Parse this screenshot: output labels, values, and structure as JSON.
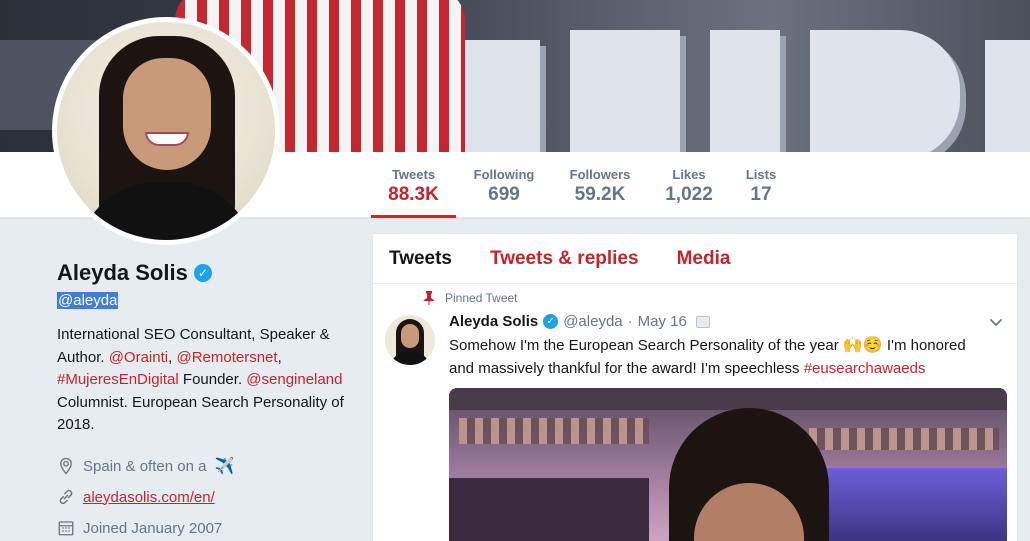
{
  "profile": {
    "name": "Aleyda Solis",
    "handle": "@aleyda",
    "bio": {
      "p1": "International SEO Consultant, Speaker & Author. ",
      "m1": "@Orainti",
      "sep1": ", ",
      "m2": "@Remotersnet",
      "sep2": ", ",
      "m3": "#MujeresEnDigital",
      "p2": " Founder. ",
      "m4": "@sengineland",
      "p3": " Columnist. European Search Personality of 2018."
    },
    "location": "Spain & often on a",
    "location_emoji": "✈️",
    "website": "aleydasolis.com/en/",
    "joined": "Joined January 2007"
  },
  "stats": [
    {
      "label": "Tweets",
      "value": "88.3K"
    },
    {
      "label": "Following",
      "value": "699"
    },
    {
      "label": "Followers",
      "value": "59.2K"
    },
    {
      "label": "Likes",
      "value": "1,022"
    },
    {
      "label": "Lists",
      "value": "17"
    }
  ],
  "tabs": [
    {
      "label": "Tweets"
    },
    {
      "label": "Tweets & replies"
    },
    {
      "label": "Media"
    }
  ],
  "tweet": {
    "pinned_label": "Pinned Tweet",
    "name": "Aleyda Solis",
    "handle": "@aleyda",
    "dot": "·",
    "date": "May 16",
    "text1": "Somehow I'm the European Search Personality of the year ",
    "emojis": "🙌☺️",
    "text2": " I'm honored and massively thankful for the award! I'm speechless ",
    "hashtag": "#eusearchawaeds"
  },
  "colors": {
    "accent": "#c8232c",
    "verified": "#1da1f2",
    "secondary_text": "#657786",
    "page_bg": "#e6ecf0"
  },
  "icons": {
    "location": "map-pin-icon",
    "website": "link-icon",
    "joined": "calendar-icon",
    "pinned": "pin-icon",
    "verified": "verified-badge-icon",
    "caret": "chevron-down-icon"
  }
}
